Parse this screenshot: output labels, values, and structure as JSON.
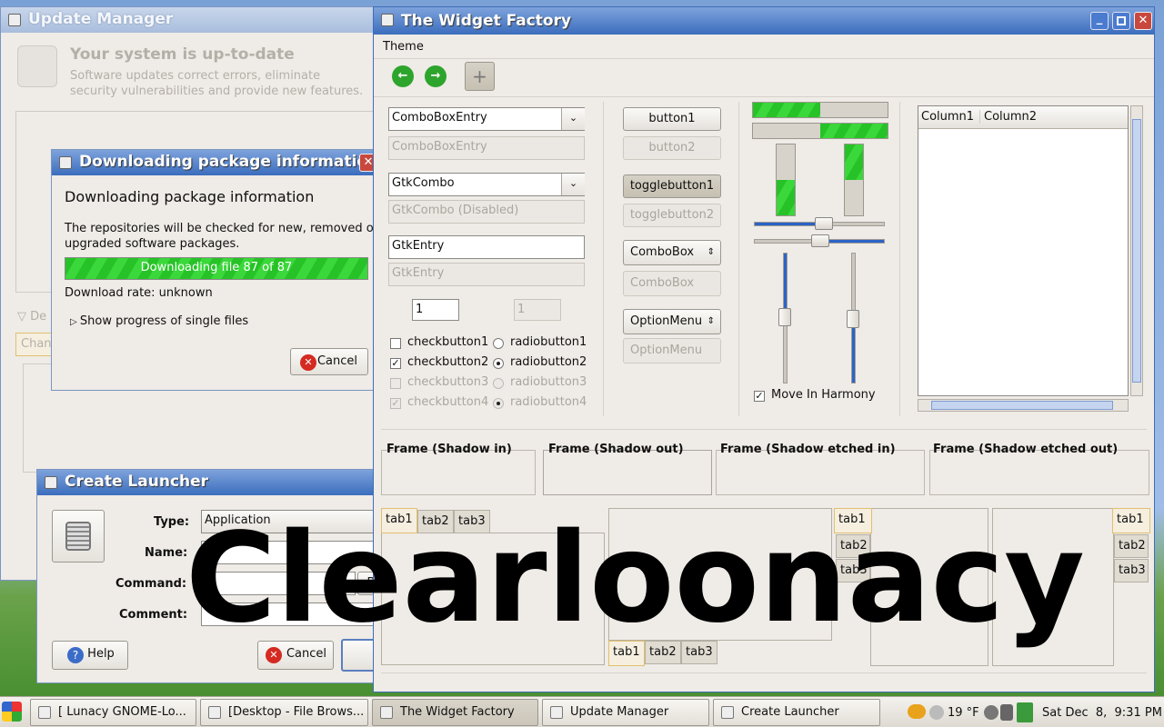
{
  "update_manager": {
    "title": "Update Manager",
    "status_title": "Your system is up-to-date",
    "status_desc_line1": "Software updates correct errors, eliminate",
    "status_desc_line2": "security vulnerabilities and provide new features.",
    "details_expander": "De",
    "changes_tab": "Chan"
  },
  "download_dialog": {
    "title": "Downloading package informatio",
    "heading": "Downloading package information",
    "desc_line1": "The repositories will be checked for new, removed or",
    "desc_line2": "upgraded software packages.",
    "progress_text": "Downloading file 87 of 87",
    "progress_fraction": 1.0,
    "rate": "Download rate: unknown",
    "expander": "Show progress of single files",
    "cancel": "Cancel"
  },
  "create_launcher": {
    "title": "Create Launcher",
    "type_label": "Type:",
    "type_value": "Application",
    "name_label": "Name:",
    "command_label": "Command:",
    "command_button_fragment": "B",
    "comment_label": "Comment:",
    "help": "Help",
    "cancel": "Cancel"
  },
  "widget_factory": {
    "title": "The Widget Factory",
    "menu_theme": "Theme",
    "combobox_entry": "ComboBoxEntry",
    "combobox_entry_disabled": "ComboBoxEntry",
    "gtkcombo": "GtkCombo",
    "gtkcombo_disabled": "GtkCombo (Disabled)",
    "gtkentry": "GtkEntry",
    "gtkentry_disabled_placeholder": "GtkEntry",
    "spin_value": "1",
    "spin_disabled_value": "1",
    "checkbutton1": "checkbutton1",
    "checkbutton2": "checkbutton2",
    "checkbutton3": "checkbutton3",
    "checkbutton4": "checkbutton4",
    "radiobutton1": "radiobutton1",
    "radiobutton2": "radiobutton2",
    "radiobutton3": "radiobutton3",
    "radiobutton4": "radiobutton4",
    "button1": "button1",
    "button2": "button2",
    "togglebutton1": "togglebutton1",
    "togglebutton2": "togglebutton2",
    "combobox": "ComboBox",
    "combobox_disabled": "ComboBox",
    "optionmenu": "OptionMenu",
    "optionmenu_disabled": "OptionMenu",
    "progress_h1": 0.5,
    "progress_h2": 0.5,
    "progress_v1": 0.5,
    "progress_v2": 0.5,
    "move_in_harmony": "Move In Harmony",
    "tree_col1": "Column1",
    "tree_col2": "Column2",
    "frame_in": "Frame (Shadow in)",
    "frame_out": "Frame (Shadow out)",
    "frame_etched_in": "Frame (Shadow etched in)",
    "frame_etched_out": "Frame (Shadow etched out)",
    "tabs": [
      "tab1",
      "tab2",
      "tab3"
    ]
  },
  "overlay_text": "Clearloonacy",
  "taskbar": {
    "items": [
      "[ Lunacy GNOME-Lo...",
      "[Desktop - File Brows...",
      "The Widget Factory",
      "Update Manager",
      "Create Launcher"
    ],
    "temperature": "19 °F",
    "clock": "Sat Dec  8,  9:31 PM"
  },
  "colors": {
    "progress_green": "#2fcf2f",
    "title_active": "#3b6dbd",
    "scale_blue": "#2b63c8"
  }
}
